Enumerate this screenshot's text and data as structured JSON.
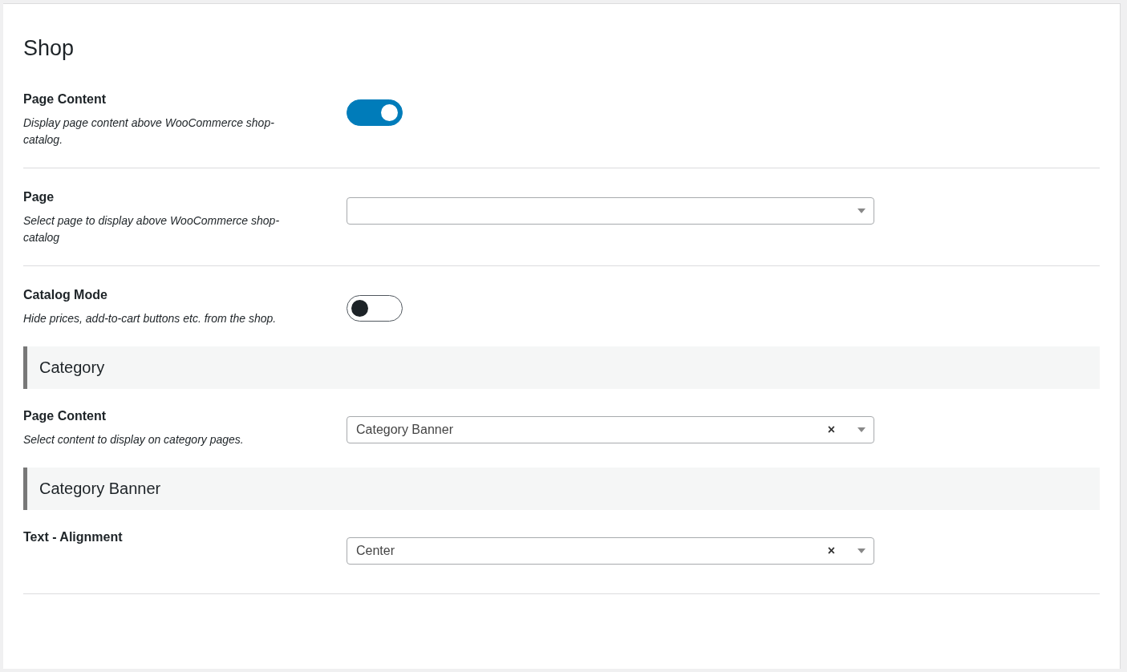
{
  "title": "Shop",
  "items": [
    {
      "kind": "toggle",
      "label": "Page Content",
      "description": "Display page content above WooCommerce shop-catalog.",
      "on": true
    },
    {
      "kind": "select",
      "label": "Page",
      "description": "Select page to display above WooCommerce shop-catalog"
    },
    {
      "kind": "toggle",
      "label": "Catalog Mode",
      "description": "Hide prices, add-to-cart buttons etc. from the shop.",
      "on": false
    },
    {
      "kind": "heading",
      "label": "Category"
    },
    {
      "kind": "select",
      "label": "Page Content",
      "description": "Select content to display on category pages.",
      "value": "Category Banner",
      "clear": "×"
    },
    {
      "kind": "heading",
      "label": "Category Banner"
    },
    {
      "kind": "select",
      "label": "Text - Alignment",
      "value": "Center",
      "clear": "×"
    }
  ]
}
